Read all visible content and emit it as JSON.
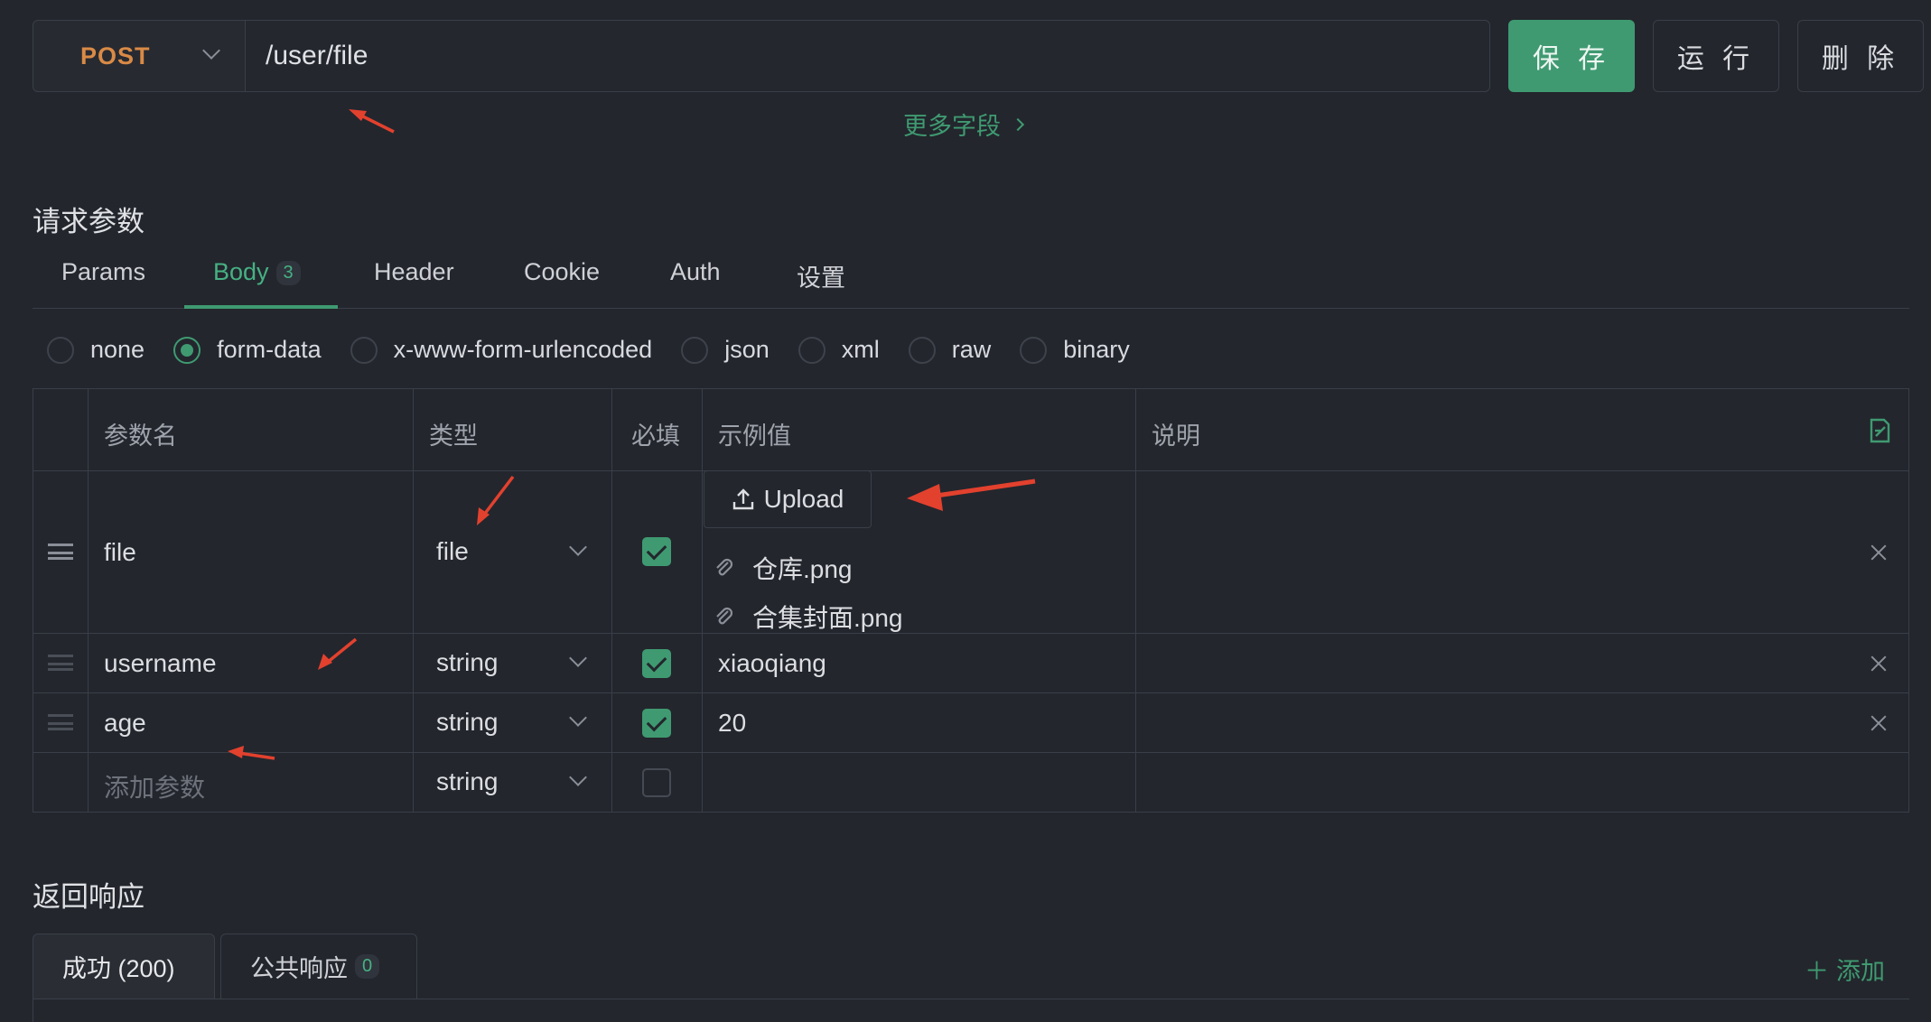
{
  "request": {
    "method": "POST",
    "url": "/user/file",
    "save_label": "保 存",
    "run_label": "运 行",
    "delete_label": "删 除",
    "more_fields": "更多字段"
  },
  "params_section": {
    "title": "请求参数",
    "tabs": [
      {
        "label": "Params"
      },
      {
        "label": "Body",
        "badge": "3"
      },
      {
        "label": "Header"
      },
      {
        "label": "Cookie"
      },
      {
        "label": "Auth"
      },
      {
        "label": "设置"
      }
    ],
    "body_types": [
      "none",
      "form-data",
      "x-www-form-urlencoded",
      "json",
      "xml",
      "raw",
      "binary"
    ],
    "selected_body_type": "form-data"
  },
  "table": {
    "headers": [
      "参数名",
      "类型",
      "必填",
      "示例值",
      "说明"
    ],
    "rows": [
      {
        "name": "file",
        "type": "file",
        "required": true,
        "example": "",
        "upload_label": "Upload",
        "files": [
          "仓库.png",
          "合集封面.png"
        ]
      },
      {
        "name": "username",
        "type": "string",
        "required": true,
        "example": "xiaoqiang"
      },
      {
        "name": "age",
        "type": "string",
        "required": true,
        "example": "20"
      }
    ],
    "new_row": {
      "placeholder": "添加参数",
      "type": "string",
      "required": false
    }
  },
  "response_section": {
    "title": "返回响应",
    "tabs": [
      {
        "label": "成功 (200)"
      },
      {
        "label": "公共响应",
        "badge": "0"
      }
    ],
    "add_label": "添加"
  },
  "colors": {
    "accent": "#3f9a71",
    "method": "#d98a46",
    "annotation": "#e2412e"
  }
}
